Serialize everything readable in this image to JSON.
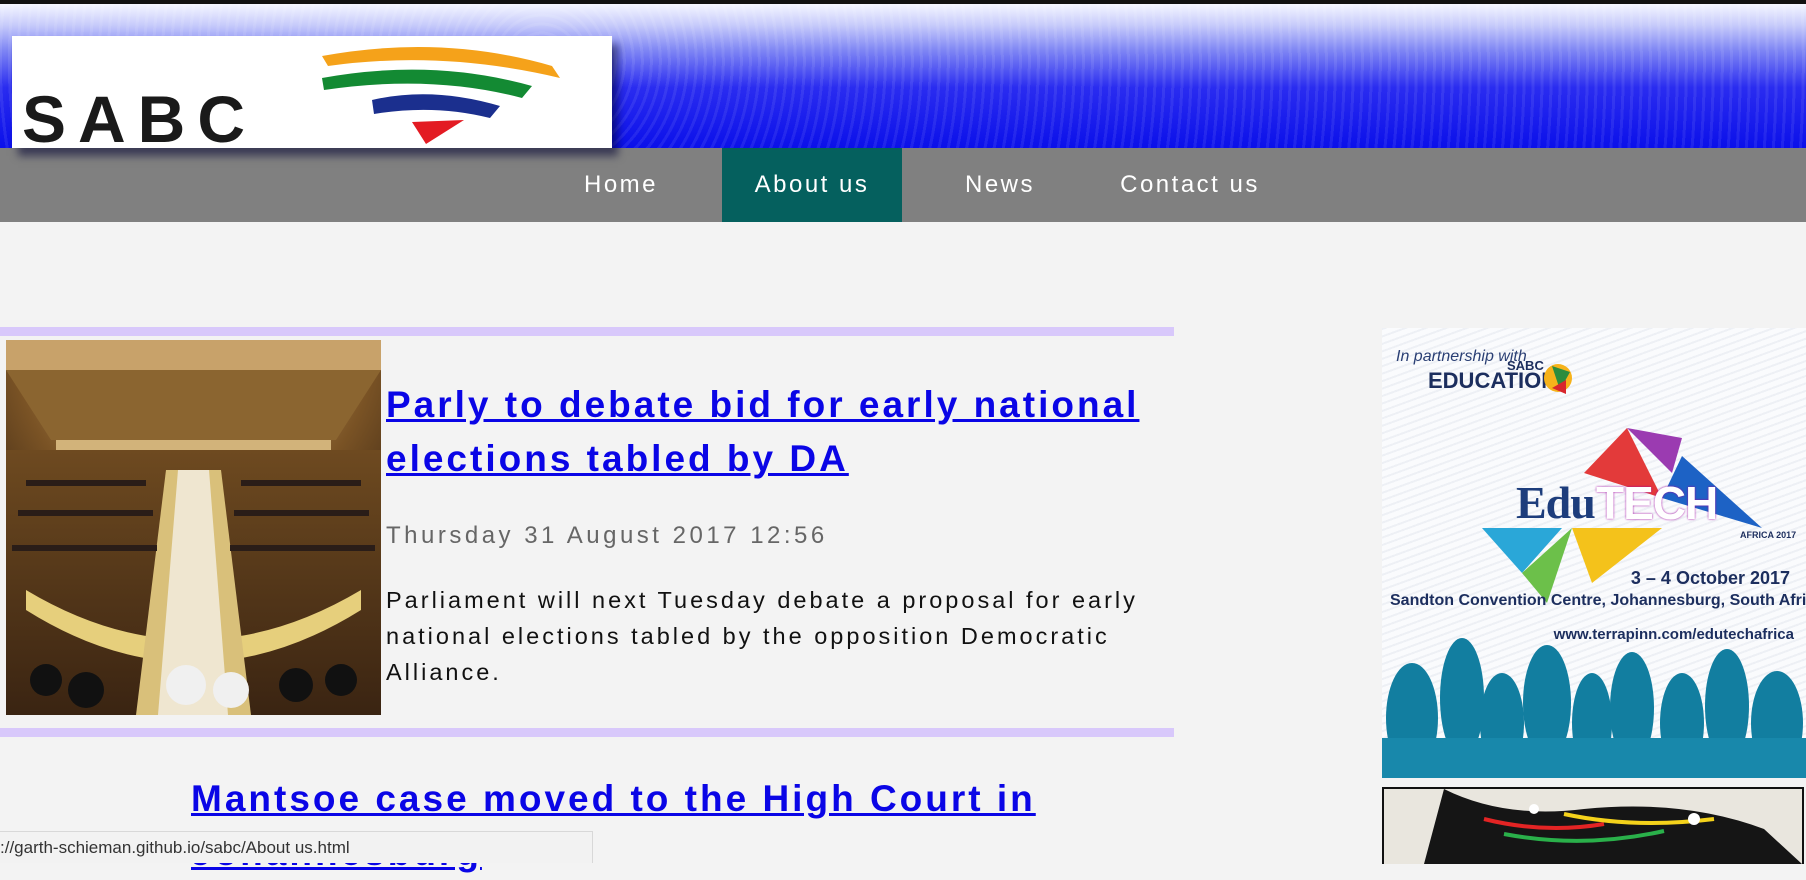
{
  "brand": {
    "logo_text": "SABC"
  },
  "nav": {
    "home": "Home",
    "about": "About us",
    "news": "News",
    "contact": "Contact us",
    "active": "About us"
  },
  "articles": [
    {
      "headline": "Parly to debate bid for early national elections tabled by DA",
      "date": "Thursday 31 August 2017 12:56",
      "summary": "Parliament will next Tuesday debate a proposal for early national elections tabled by the opposition Democratic Alliance."
    },
    {
      "headline": "Mantsoe case moved to the High Court in Johannesburg"
    }
  ],
  "status_bar": {
    "url": "://garth-schieman.github.io/sabc/About us.html"
  },
  "ad": {
    "partner_line": "In partnership with",
    "partner_brand": "EDUCATION",
    "partner_sabc": "SABC",
    "title_edu": "Edu",
    "title_tech": "TECH",
    "africa_label": "AFRICA 2017",
    "dates": "3 – 4 October 2017",
    "venue": "Sandton Convention Centre, Johannesburg, South Africa",
    "url": "www.terrapinn.com/edutechafrica"
  },
  "colors": {
    "nav_bg": "#808080",
    "nav_active": "#05605e",
    "link": "#0a05e6",
    "divider": "#d8c8fb",
    "header_blue": "#0b10ea"
  }
}
